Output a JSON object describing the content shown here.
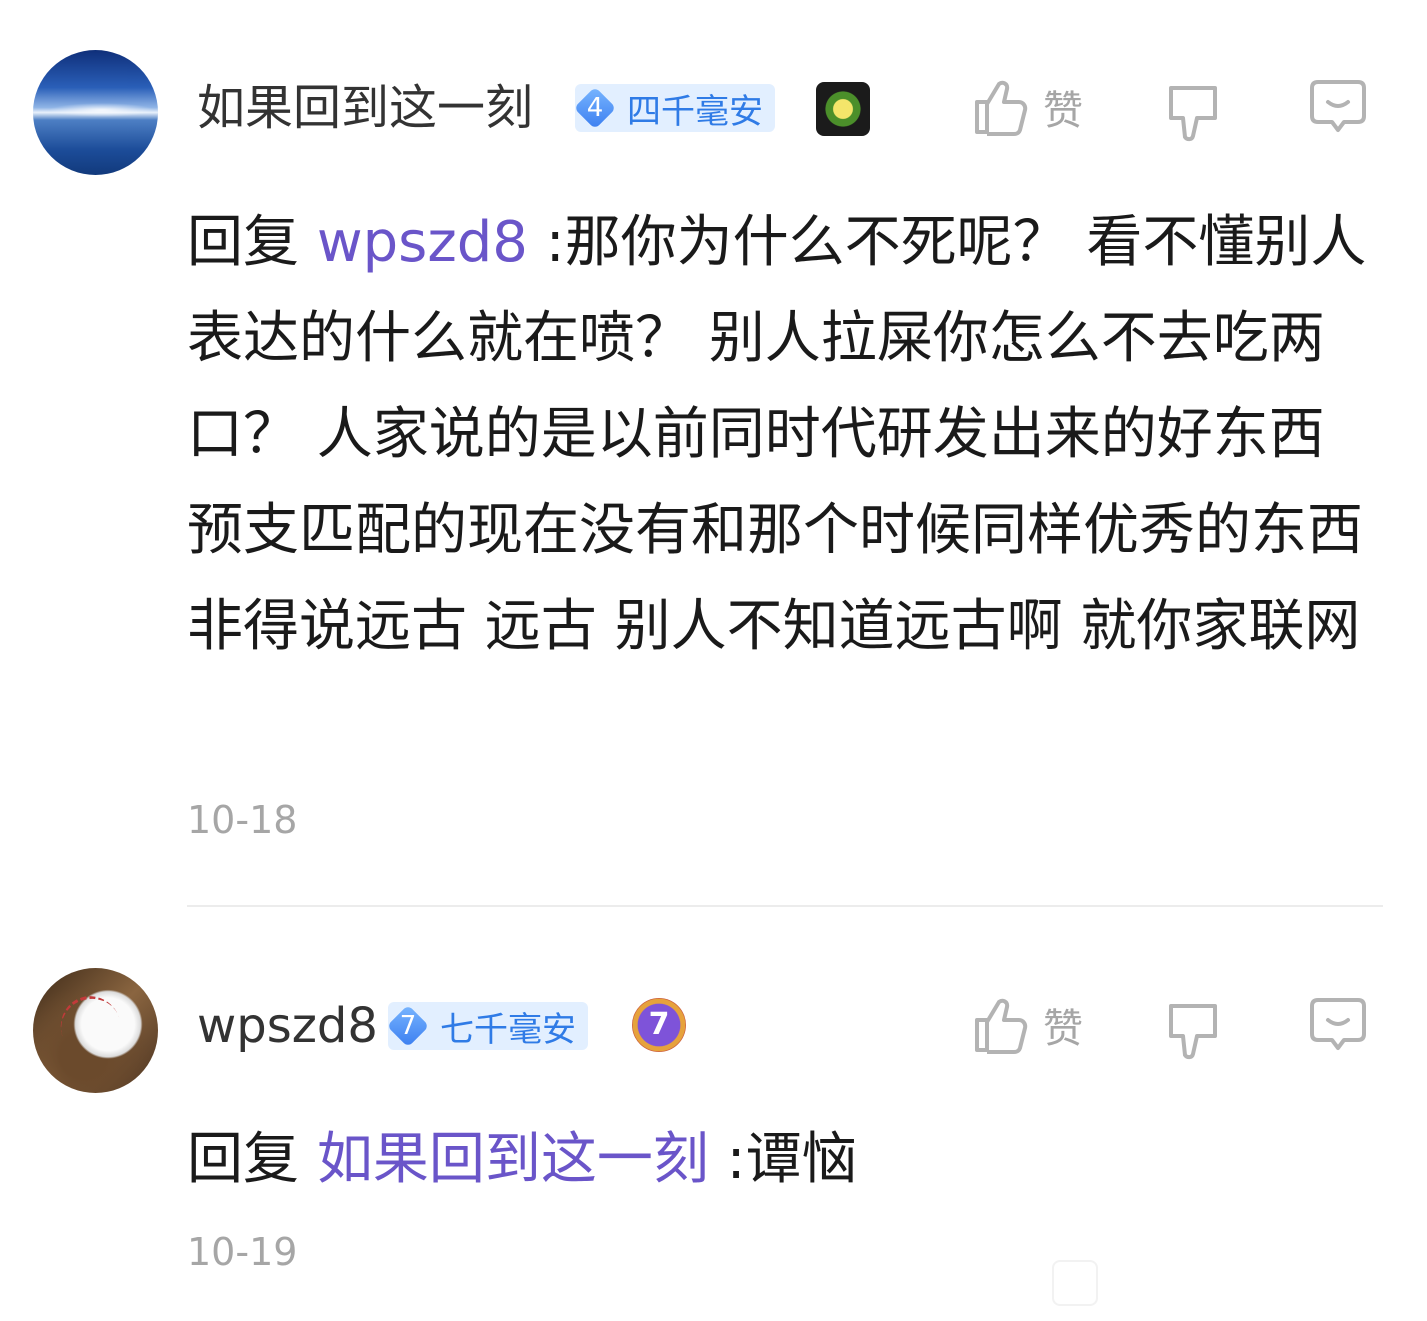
{
  "comments": [
    {
      "username": "如果回到这一刻",
      "level_number": "4",
      "level_title": "四千毫安",
      "like_label": "赞",
      "reply_prefix": "回复",
      "mention": "wpszd8",
      "text": " :那你为什么不死呢？ 看不懂别人表达的什么就在喷？ 别人拉屎你怎么不去吃两口？ 人家说的是以前同时代研发出来的好东西 预支匹配的现在没有和那个时候同样优秀的东西 非得说远古 远古 别人不知道远古啊 就你家联网",
      "date": "10-18"
    },
    {
      "username": "wpszd8",
      "level_number": "7",
      "level_title": "七千毫安",
      "medal_number": "7",
      "like_label": "赞",
      "reply_prefix": "回复",
      "mention": "如果回到这一刻",
      "text": " :谭恼",
      "date": "10-19"
    }
  ],
  "icons": {
    "like": "thumbs-up-icon",
    "dislike": "thumbs-down-icon",
    "comment": "chat-bubble-icon"
  },
  "colors": {
    "mention": "#6a55c9",
    "level_badge_bg": "#e2efff",
    "level_text": "#2f7be6",
    "muted": "#a6a6a6"
  }
}
